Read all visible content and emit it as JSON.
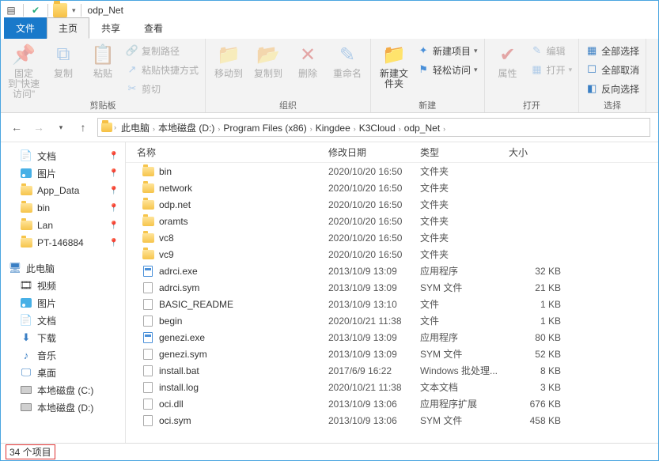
{
  "title": "odp_Net",
  "tabs": {
    "file": "文件",
    "home": "主页",
    "share": "共享",
    "view": "查看"
  },
  "ribbon": {
    "pin": "固定到\"快速访问\"",
    "copy": "复制",
    "paste": "粘贴",
    "copypath": "复制路径",
    "pastelnk": "粘贴快捷方式",
    "cut": "剪切",
    "g_clip": "剪贴板",
    "moveto": "移动到",
    "copyto": "复制到",
    "delete": "删除",
    "rename": "重命名",
    "g_org": "组织",
    "newfolder": "新建文件夹",
    "newitem": "新建项目",
    "easyaccess": "轻松访问",
    "g_new": "新建",
    "properties": "属性",
    "edit": "编辑",
    "open": "打开",
    "g_open": "打开",
    "selall": "全部选择",
    "selnone": "全部取消",
    "selinv": "反向选择",
    "g_sel": "选择"
  },
  "breadcrumbs": [
    "此电脑",
    "本地磁盘 (D:)",
    "Program Files (x86)",
    "Kingdee",
    "K3Cloud",
    "odp_Net"
  ],
  "nav": {
    "quick": [
      {
        "label": "文档",
        "icon": "doc",
        "pin": true
      },
      {
        "label": "图片",
        "icon": "pic",
        "pin": true
      },
      {
        "label": "App_Data",
        "icon": "folder",
        "pin": true
      },
      {
        "label": "bin",
        "icon": "folder",
        "pin": true
      },
      {
        "label": "Lan",
        "icon": "folder",
        "pin": true
      },
      {
        "label": "PT-146884",
        "icon": "folder",
        "pin": true
      }
    ],
    "thispc": "此电脑",
    "pcitems": [
      {
        "label": "视频",
        "icon": "vid"
      },
      {
        "label": "图片",
        "icon": "pic"
      },
      {
        "label": "文档",
        "icon": "doc"
      },
      {
        "label": "下载",
        "icon": "dl"
      },
      {
        "label": "音乐",
        "icon": "mus"
      },
      {
        "label": "桌面",
        "icon": "desk"
      },
      {
        "label": "本地磁盘 (C:)",
        "icon": "drive"
      },
      {
        "label": "本地磁盘 (D:)",
        "icon": "drive"
      }
    ]
  },
  "cols": {
    "name": "名称",
    "date": "修改日期",
    "type": "类型",
    "size": "大小"
  },
  "files": [
    {
      "name": "bin",
      "date": "2020/10/20 16:50",
      "type": "文件夹",
      "size": "",
      "icon": "folder"
    },
    {
      "name": "network",
      "date": "2020/10/20 16:50",
      "type": "文件夹",
      "size": "",
      "icon": "folder"
    },
    {
      "name": "odp.net",
      "date": "2020/10/20 16:50",
      "type": "文件夹",
      "size": "",
      "icon": "folder"
    },
    {
      "name": "oramts",
      "date": "2020/10/20 16:50",
      "type": "文件夹",
      "size": "",
      "icon": "folder"
    },
    {
      "name": "vc8",
      "date": "2020/10/20 16:50",
      "type": "文件夹",
      "size": "",
      "icon": "folder"
    },
    {
      "name": "vc9",
      "date": "2020/10/20 16:50",
      "type": "文件夹",
      "size": "",
      "icon": "folder"
    },
    {
      "name": "adrci.exe",
      "date": "2013/10/9 13:09",
      "type": "应用程序",
      "size": "32 KB",
      "icon": "exe"
    },
    {
      "name": "adrci.sym",
      "date": "2013/10/9 13:09",
      "type": "SYM 文件",
      "size": "21 KB",
      "icon": "file"
    },
    {
      "name": "BASIC_README",
      "date": "2013/10/9 13:10",
      "type": "文件",
      "size": "1 KB",
      "icon": "file"
    },
    {
      "name": "begin",
      "date": "2020/10/21 11:38",
      "type": "文件",
      "size": "1 KB",
      "icon": "file"
    },
    {
      "name": "genezi.exe",
      "date": "2013/10/9 13:09",
      "type": "应用程序",
      "size": "80 KB",
      "icon": "exe"
    },
    {
      "name": "genezi.sym",
      "date": "2013/10/9 13:09",
      "type": "SYM 文件",
      "size": "52 KB",
      "icon": "file"
    },
    {
      "name": "install.bat",
      "date": "2017/6/9 16:22",
      "type": "Windows 批处理...",
      "size": "8 KB",
      "icon": "file"
    },
    {
      "name": "install.log",
      "date": "2020/10/21 11:38",
      "type": "文本文档",
      "size": "3 KB",
      "icon": "file"
    },
    {
      "name": "oci.dll",
      "date": "2013/10/9 13:06",
      "type": "应用程序扩展",
      "size": "676 KB",
      "icon": "file"
    },
    {
      "name": "oci.sym",
      "date": "2013/10/9 13:06",
      "type": "SYM 文件",
      "size": "458 KB",
      "icon": "file"
    }
  ],
  "status": "34 个项目"
}
